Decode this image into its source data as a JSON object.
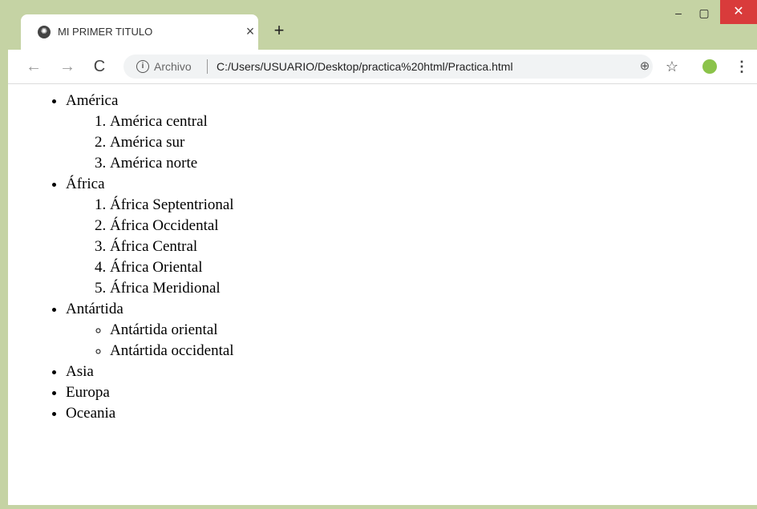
{
  "tab": {
    "title": "MI PRIMER TITULO",
    "close": "×",
    "new_tab": "+"
  },
  "window_controls": {
    "minimize": "–",
    "maximize": "▢",
    "close": "✕"
  },
  "toolbar": {
    "back": "←",
    "forward": "→",
    "reload": "C",
    "info": "i",
    "archivo_label": "Archivo",
    "url": "C:/Users/USUARIO/Desktop/practica%20html/Practica.html",
    "zoom": "⊕",
    "star": "☆",
    "menu": "⋮"
  },
  "page": {
    "america": {
      "label": "América",
      "items": [
        "América central",
        "América sur",
        "América norte"
      ]
    },
    "africa": {
      "label": "África",
      "items": [
        "África Septentrional",
        "África Occidental",
        "África Central",
        "África Oriental",
        "África Meridional"
      ]
    },
    "antartida": {
      "label": "Antártida",
      "items": [
        "Antártida oriental",
        "Antártida occidental"
      ]
    },
    "others": [
      "Asia",
      "Europa",
      "Oceania"
    ]
  },
  "colors": {
    "frame": "#c5d3a4",
    "close_button": "#d93b3b",
    "extension": "#8bc34a"
  }
}
